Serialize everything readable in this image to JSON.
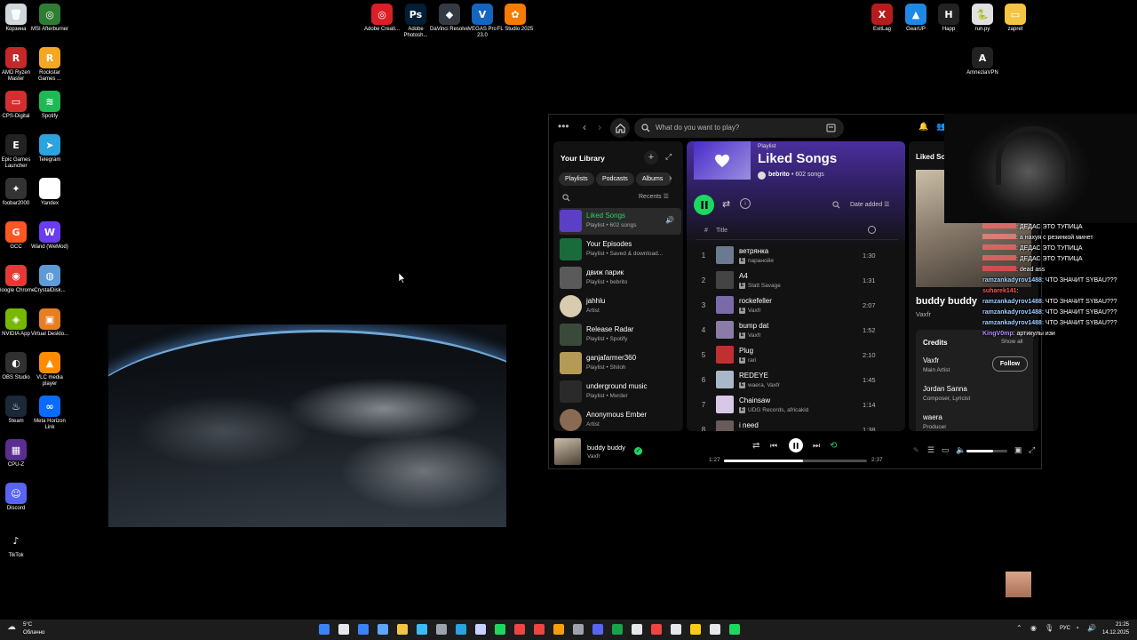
{
  "desktop": {
    "icons_left": [
      {
        "label": "Корзина",
        "color": "#cfd8dc",
        "glyph": "🗑"
      },
      {
        "label": "MSI Afterburner",
        "color": "#2f7d32",
        "glyph": "◎"
      },
      {
        "label": "AMD Ryzen Master",
        "color": "#c62828",
        "glyph": "R"
      },
      {
        "label": "Rockstar Games ...",
        "color": "#f5a623",
        "glyph": "R"
      },
      {
        "label": "CPS-Digital",
        "color": "#d32f2f",
        "glyph": "▭"
      },
      {
        "label": "Spotify",
        "color": "#1db954",
        "glyph": "≋"
      },
      {
        "label": "Epic Games Launcher",
        "color": "#222222",
        "glyph": "E"
      },
      {
        "label": "Telegram",
        "color": "#2aa3df",
        "glyph": "➤"
      },
      {
        "label": "foobar2000",
        "color": "#333333",
        "glyph": "✦"
      },
      {
        "label": "Yandex",
        "color": "#ffffff",
        "glyph": "Y"
      },
      {
        "label": "GCC",
        "color": "#ff5722",
        "glyph": "G"
      },
      {
        "label": "Wand (WeMod)",
        "color": "#6a3df0",
        "glyph": "W"
      },
      {
        "label": "Google Chrome",
        "color": "#e53935",
        "glyph": "◉"
      },
      {
        "label": "CrystalDisk...",
        "color": "#5c9bd6",
        "glyph": "◍"
      },
      {
        "label": "NVIDIA App",
        "color": "#76b900",
        "glyph": "◈"
      },
      {
        "label": "Virtual Deskto...",
        "color": "#e67e22",
        "glyph": "▣"
      },
      {
        "label": "OBS Studio",
        "color": "#303030",
        "glyph": "◐"
      },
      {
        "label": "VLC media player",
        "color": "#ff8c00",
        "glyph": "▲"
      },
      {
        "label": "Steam",
        "color": "#1b2838",
        "glyph": "♨"
      },
      {
        "label": "Meta Horizon Link",
        "color": "#0a6cff",
        "glyph": "∞"
      },
      {
        "label": "CPU-Z",
        "color": "#5a2d91",
        "glyph": "▦"
      },
      {
        "label": "Discord",
        "color": "#5865f2",
        "glyph": "☺"
      },
      {
        "label": "TikTok",
        "color": "#000000",
        "glyph": "♪"
      }
    ],
    "icons_top": [
      {
        "label": "Adobe Creati...",
        "color": "#da1f26",
        "glyph": "◎"
      },
      {
        "label": "Adobe Photosh...",
        "color": "#001e36",
        "glyph": "Ps"
      },
      {
        "label": "DaVinci Resolve",
        "color": "#333a44",
        "glyph": "◆"
      },
      {
        "label": "VEGAS Pro 23.0",
        "color": "#1565c0",
        "glyph": "V"
      },
      {
        "label": "FL Studio 2025",
        "color": "#f57c00",
        "glyph": "✿"
      }
    ],
    "icons_right": [
      {
        "label": "ExitLag",
        "color": "#b71c1c",
        "glyph": "X"
      },
      {
        "label": "GearUP",
        "color": "#1e88e5",
        "glyph": "▲"
      },
      {
        "label": "Happ",
        "color": "#222222",
        "glyph": "H"
      },
      {
        "label": "run.py",
        "color": "#e0e0e0",
        "glyph": "🐍"
      },
      {
        "label": "zapret",
        "color": "#f4c542",
        "glyph": "▭"
      },
      {
        "label": "AmneziaVPN",
        "color": "#222222",
        "glyph": "A"
      }
    ]
  },
  "spotify": {
    "search_placeholder": "What do you want to play?",
    "library": {
      "title": "Your Library",
      "chips": [
        "Playlists",
        "Podcasts",
        "Albums"
      ],
      "sort": "Recents",
      "items": [
        {
          "title": "Liked Songs",
          "sub": "Playlist • 602 songs",
          "color": "#5b3fc4",
          "active": true
        },
        {
          "title": "Your Episodes",
          "sub": "Playlist • Saved & download...",
          "color": "#1a6b3c",
          "active": false
        },
        {
          "title": "движ парик",
          "sub": "Playlist • bebrito",
          "color": "#5a5a5a",
          "active": false
        },
        {
          "title": "jahhlu",
          "sub": "Artist",
          "color": "#d8cbb0",
          "active": false
        },
        {
          "title": "Release Radar",
          "sub": "Playlist • Spotify",
          "color": "#3a4a3a",
          "active": false
        },
        {
          "title": "ganjafarmer360",
          "sub": "Playlist • Shiloh",
          "color": "#b59a57",
          "active": false
        },
        {
          "title": "underground music",
          "sub": "Playlist • Mxrder",
          "color": "#2a2a2a",
          "active": false
        },
        {
          "title": "Anonymous Ember",
          "sub": "Artist",
          "color": "#8a6a52",
          "active": false
        }
      ]
    },
    "playlist": {
      "type_label": "Playlist",
      "title": "Liked Songs",
      "owner": "bebrito",
      "count": "• 602 songs",
      "sort": "Date added",
      "col_num": "#",
      "col_title": "Title",
      "tracks": [
        {
          "n": "1",
          "title": "ветрянка",
          "artist": "паранойя",
          "dur": "1:30",
          "color": "#6b7a8f"
        },
        {
          "n": "2",
          "title": "A4",
          "artist": "Slatt Savage",
          "dur": "1:31",
          "color": "#444444"
        },
        {
          "n": "3",
          "title": "rockefeller",
          "artist": "Vaxfr",
          "dur": "2:07",
          "color": "#7a6aa8"
        },
        {
          "n": "4",
          "title": "bump dat",
          "artist": "Vaxfr",
          "dur": "1:52",
          "color": "#8a7ca6"
        },
        {
          "n": "5",
          "title": "Plug",
          "artist": "rari",
          "dur": "2:10",
          "color": "#c03030"
        },
        {
          "n": "6",
          "title": "REDEYE",
          "artist": "waera, Vaxfr",
          "dur": "1:45",
          "color": "#a8b8c8"
        },
        {
          "n": "7",
          "title": "Chainsaw",
          "artist": "UDG Records, africakid",
          "dur": "1:14",
          "color": "#d8c8e8"
        },
        {
          "n": "8",
          "title": "i need",
          "artist": "",
          "dur": "1:38",
          "color": "#6a5a5a"
        }
      ]
    },
    "now_playing_panel": {
      "header": "Liked So",
      "song_title": "buddy buddy",
      "artist": "Vaxfr",
      "credits_title": "Credits",
      "show_all": "Show all",
      "credits": [
        {
          "name": "Vaxfr",
          "role": "Main Artist"
        },
        {
          "name": "Jordan Sanna",
          "role": "Composer, Lyricist"
        },
        {
          "name": "waera",
          "role": "Producer"
        }
      ],
      "follow": "Follow"
    },
    "player": {
      "title": "buddy buddy",
      "artist": "Vaxfr",
      "elapsed": "1:27",
      "total": "2:37",
      "progress": 0.55,
      "volume": 0.65
    }
  },
  "chat": [
    {
      "user": "",
      "text": "ДЕДАС ЭТО ТУПИЦА",
      "ucolor": "#ff6b6b"
    },
    {
      "user": "",
      "text": "а нахуя с резинкой минет",
      "ucolor": "#ff8a80"
    },
    {
      "user": "",
      "text": "ДЕДАС ЭТО ТУПИЦА",
      "ucolor": "#ff6b6b"
    },
    {
      "user": "",
      "text": "ДЕДАС ЭТО ТУПИЦА",
      "ucolor": "#ff6b6b"
    },
    {
      "user": "",
      "text": "dead ass",
      "ucolor": "#ff5252"
    },
    {
      "user": "ramzankadyrov1488",
      "text": "ЧТО ЗНАЧИТ SYBAU???",
      "ucolor": "#9ecbff"
    },
    {
      "user": "suharek141",
      "text": "",
      "ucolor": "#ff5252"
    },
    {
      "user": "ramzankadyrov1488",
      "text": "ЧТО ЗНАЧИТ SYBAU???",
      "ucolor": "#9ecbff"
    },
    {
      "user": "ramzankadyrov1488",
      "text": "ЧТО ЗНАЧИТ SYBAU???",
      "ucolor": "#9ecbff"
    },
    {
      "user": "ramzankadyrov1488",
      "text": "ЧТО ЗНАЧИТ SYBAU???",
      "ucolor": "#9ecbff"
    },
    {
      "user": "KingV0mp",
      "text": "артикулы изи",
      "ucolor": "#b388ff"
    }
  ],
  "taskbar": {
    "weather_temp": "5°C",
    "weather_desc": "Облачно",
    "lang": "РУС",
    "time": "21:25",
    "date": "14.12.2025"
  }
}
